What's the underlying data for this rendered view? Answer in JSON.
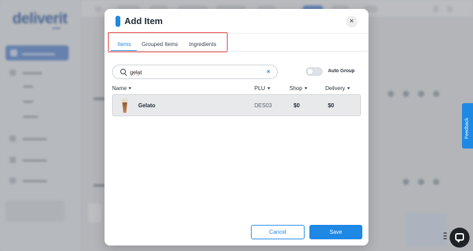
{
  "modal": {
    "title": "Add Item",
    "close_label": "×",
    "tabs": [
      {
        "label": "Items",
        "active": true
      },
      {
        "label": "Grouped Items",
        "active": false
      },
      {
        "label": "Ingredients",
        "active": false
      }
    ],
    "search": {
      "value": "gelat",
      "placeholder": "",
      "clear_label": "×"
    },
    "auto_group": {
      "label": "Auto Group",
      "enabled": false
    },
    "table": {
      "columns": [
        "Name",
        "PLU",
        "Shop",
        "Delivery"
      ],
      "rows": [
        {
          "name": "Gelato",
          "plu": "DES03",
          "shop": "$0",
          "delivery": "$0"
        }
      ]
    },
    "buttons": {
      "cancel": "Cancel",
      "save": "Save"
    }
  },
  "feedback_label": "Feedback",
  "colors": {
    "accent": "#1e88e5",
    "highlight_border": "#e53935"
  }
}
